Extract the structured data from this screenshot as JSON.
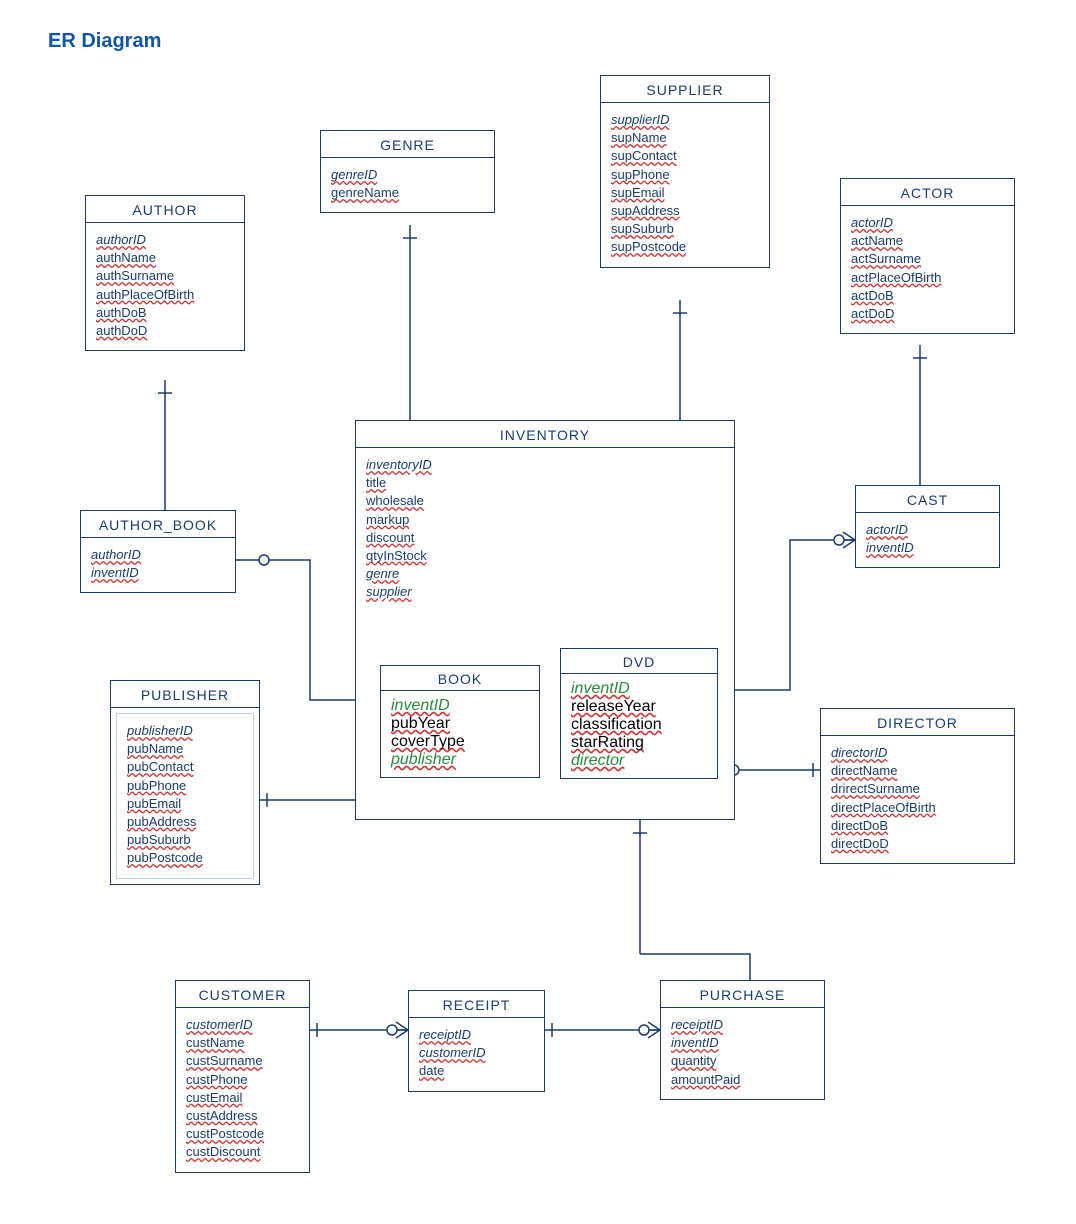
{
  "title": "ER Diagram",
  "chart_data": {
    "type": "er-diagram",
    "entities": [
      {
        "name": "AUTHOR",
        "attrs": [
          {
            "n": "authorID",
            "pk": true
          },
          {
            "n": "authName"
          },
          {
            "n": "authSurname"
          },
          {
            "n": "authPlaceOfBirth"
          },
          {
            "n": "authDoB"
          },
          {
            "n": "authDoD"
          }
        ]
      },
      {
        "name": "GENRE",
        "attrs": [
          {
            "n": "genreID",
            "pk": true
          },
          {
            "n": "genreName"
          }
        ]
      },
      {
        "name": "SUPPLIER",
        "attrs": [
          {
            "n": "supplierID",
            "pk": true
          },
          {
            "n": "supName"
          },
          {
            "n": "supContact"
          },
          {
            "n": "supPhone"
          },
          {
            "n": "supEmail"
          },
          {
            "n": "supAddress"
          },
          {
            "n": "supSuburb"
          },
          {
            "n": "supPostcode"
          }
        ]
      },
      {
        "name": "ACTOR",
        "attrs": [
          {
            "n": "actorID",
            "pk": true
          },
          {
            "n": "actName"
          },
          {
            "n": "actSurname"
          },
          {
            "n": "actPlaceOfBirth"
          },
          {
            "n": "actDoB"
          },
          {
            "n": "actDoD"
          }
        ]
      },
      {
        "name": "AUTHOR_BOOK",
        "attrs": [
          {
            "n": "authorID",
            "pk": true,
            "fk": true
          },
          {
            "n": "inventID",
            "pk": true,
            "fk": true
          }
        ]
      },
      {
        "name": "INVENTORY",
        "attrs": [
          {
            "n": "inventoryID",
            "pk": true
          },
          {
            "n": "title"
          },
          {
            "n": "wholesale"
          },
          {
            "n": "markup"
          },
          {
            "n": "discount"
          },
          {
            "n": "qtyInStock"
          },
          {
            "n": "genre",
            "fk": true
          },
          {
            "n": "supplier",
            "fk": true
          }
        ]
      },
      {
        "name": "CAST",
        "attrs": [
          {
            "n": "actorID",
            "pk": true,
            "fk": true
          },
          {
            "n": "inventID",
            "pk": true,
            "fk": true
          }
        ]
      },
      {
        "name": "PUBLISHER",
        "attrs": [
          {
            "n": "publisherID",
            "pk": true
          },
          {
            "n": "pubName"
          },
          {
            "n": "pubContact"
          },
          {
            "n": "pubPhone"
          },
          {
            "n": "pubEmail"
          },
          {
            "n": "pubAddress"
          },
          {
            "n": "pubSuburb"
          },
          {
            "n": "pubPostcode"
          }
        ]
      },
      {
        "name": "BOOK",
        "parent": "INVENTORY",
        "attrs": [
          {
            "n": "inventID",
            "pk": true,
            "fk": true
          },
          {
            "n": "pubYear"
          },
          {
            "n": "coverType"
          },
          {
            "n": "publisher",
            "fk": true
          }
        ]
      },
      {
        "name": "DVD",
        "parent": "INVENTORY",
        "attrs": [
          {
            "n": "inventID",
            "pk": true,
            "fk": true
          },
          {
            "n": "releaseYear"
          },
          {
            "n": "classification"
          },
          {
            "n": "starRating"
          },
          {
            "n": "director",
            "fk": true
          }
        ]
      },
      {
        "name": "DIRECTOR",
        "attrs": [
          {
            "n": "directorID",
            "pk": true
          },
          {
            "n": "directName"
          },
          {
            "n": "drirectSurname"
          },
          {
            "n": "directPlaceOfBirth"
          },
          {
            "n": "directDoB"
          },
          {
            "n": "directDoD"
          }
        ]
      },
      {
        "name": "CUSTOMER",
        "attrs": [
          {
            "n": "customerID",
            "pk": true
          },
          {
            "n": "custName"
          },
          {
            "n": "custSurname"
          },
          {
            "n": "custPhone"
          },
          {
            "n": "custEmail"
          },
          {
            "n": "custAddress"
          },
          {
            "n": "custPostcode"
          },
          {
            "n": "custDiscount"
          }
        ]
      },
      {
        "name": "RECEIPT",
        "attrs": [
          {
            "n": "receiptID",
            "pk": true
          },
          {
            "n": "customerID",
            "fk": true
          },
          {
            "n": "date"
          }
        ]
      },
      {
        "name": "PURCHASE",
        "attrs": [
          {
            "n": "receiptID",
            "pk": true,
            "fk": true
          },
          {
            "n": "inventID",
            "pk": true,
            "fk": true
          },
          {
            "n": "quantity"
          },
          {
            "n": "amountPaid"
          }
        ]
      }
    ],
    "relationships": [
      {
        "from": "AUTHOR",
        "to": "AUTHOR_BOOK",
        "card": "1:N"
      },
      {
        "from": "AUTHOR_BOOK",
        "to": "BOOK",
        "card": "N:1"
      },
      {
        "from": "GENRE",
        "to": "INVENTORY",
        "card": "1:N"
      },
      {
        "from": "SUPPLIER",
        "to": "INVENTORY",
        "card": "1:N"
      },
      {
        "from": "ACTOR",
        "to": "CAST",
        "card": "1:N"
      },
      {
        "from": "CAST",
        "to": "DVD",
        "card": "N:1"
      },
      {
        "from": "DIRECTOR",
        "to": "DVD",
        "card": "1:N"
      },
      {
        "from": "PUBLISHER",
        "to": "BOOK",
        "card": "1:N"
      },
      {
        "from": "INVENTORY",
        "to": "PURCHASE",
        "card": "1:N"
      },
      {
        "from": "RECEIPT",
        "to": "PURCHASE",
        "card": "1:N"
      },
      {
        "from": "CUSTOMER",
        "to": "RECEIPT",
        "card": "1:N"
      }
    ]
  },
  "entities": {
    "author": {
      "title": "AUTHOR",
      "attrs": [
        "authorID",
        "authName",
        "authSurname",
        "authPlaceOfBirth",
        "authDoB",
        "authDoD"
      ]
    },
    "genre": {
      "title": "GENRE",
      "attrs": [
        "genreID",
        "genreName"
      ]
    },
    "supplier": {
      "title": "SUPPLIER",
      "attrs": [
        "supplierID",
        "supName",
        "supContact",
        "supPhone",
        "supEmail",
        "supAddress",
        "supSuburb",
        "supPostcode"
      ]
    },
    "actor": {
      "title": "ACTOR",
      "attrs": [
        "actorID",
        "actName",
        "actSurname",
        "actPlaceOfBirth",
        "actDoB",
        "actDoD"
      ]
    },
    "author_book": {
      "title": "AUTHOR_BOOK",
      "attrs": [
        "authorID",
        "inventID"
      ]
    },
    "inventory": {
      "title": "INVENTORY",
      "attrs": [
        "inventoryID",
        "title",
        "wholesale",
        "markup",
        "discount",
        "qtyInStock",
        "genre",
        "supplier"
      ]
    },
    "cast": {
      "title": "CAST",
      "attrs": [
        "actorID",
        "inventID"
      ]
    },
    "publisher": {
      "title": "PUBLISHER",
      "attrs": [
        "publisherID",
        "pubName",
        "pubContact",
        "pubPhone",
        "pubEmail",
        "pubAddress",
        "pubSuburb",
        "pubPostcode"
      ]
    },
    "book": {
      "title": "BOOK",
      "attrs": [
        "inventID",
        "pubYear",
        "coverType",
        "publisher"
      ]
    },
    "dvd": {
      "title": "DVD",
      "attrs": [
        "inventID",
        "releaseYear",
        "classification",
        "starRating",
        "director"
      ]
    },
    "director": {
      "title": "DIRECTOR",
      "attrs": [
        "directorID",
        "directName",
        "drirectSurname",
        "directPlaceOfBirth",
        "directDoB",
        "directDoD"
      ]
    },
    "customer": {
      "title": "CUSTOMER",
      "attrs": [
        "customerID",
        "custName",
        "custSurname",
        "custPhone",
        "custEmail",
        "custAddress",
        "custPostcode",
        "custDiscount"
      ]
    },
    "receipt": {
      "title": "RECEIPT",
      "attrs": [
        "receiptID",
        "customerID",
        "date"
      ]
    },
    "purchase": {
      "title": "PURCHASE",
      "attrs": [
        "receiptID",
        "inventID",
        "quantity",
        "amountPaid"
      ]
    }
  }
}
